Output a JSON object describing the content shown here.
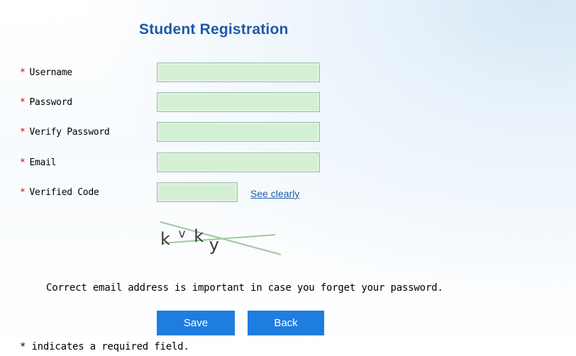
{
  "form": {
    "title": "Student Registration",
    "required_marker": "*",
    "fields": [
      {
        "label": "Username",
        "value": ""
      },
      {
        "label": "Password",
        "value": ""
      },
      {
        "label": "Verify Password",
        "value": ""
      },
      {
        "label": "Email",
        "value": ""
      },
      {
        "label": "Verified Code",
        "value": ""
      }
    ],
    "see_clearly_link": "See clearly",
    "captcha_text": "kvky",
    "email_note": "Correct email address is important in case you forget your password.",
    "save_label": "Save",
    "back_label": "Back",
    "required_note": "* indicates a required field."
  },
  "colors": {
    "title": "#1f5aa8",
    "required_star": "#cc0000",
    "field_bg": "#d4f0d4",
    "button_bg": "#1f7ddf",
    "link": "#1f5aa8"
  }
}
